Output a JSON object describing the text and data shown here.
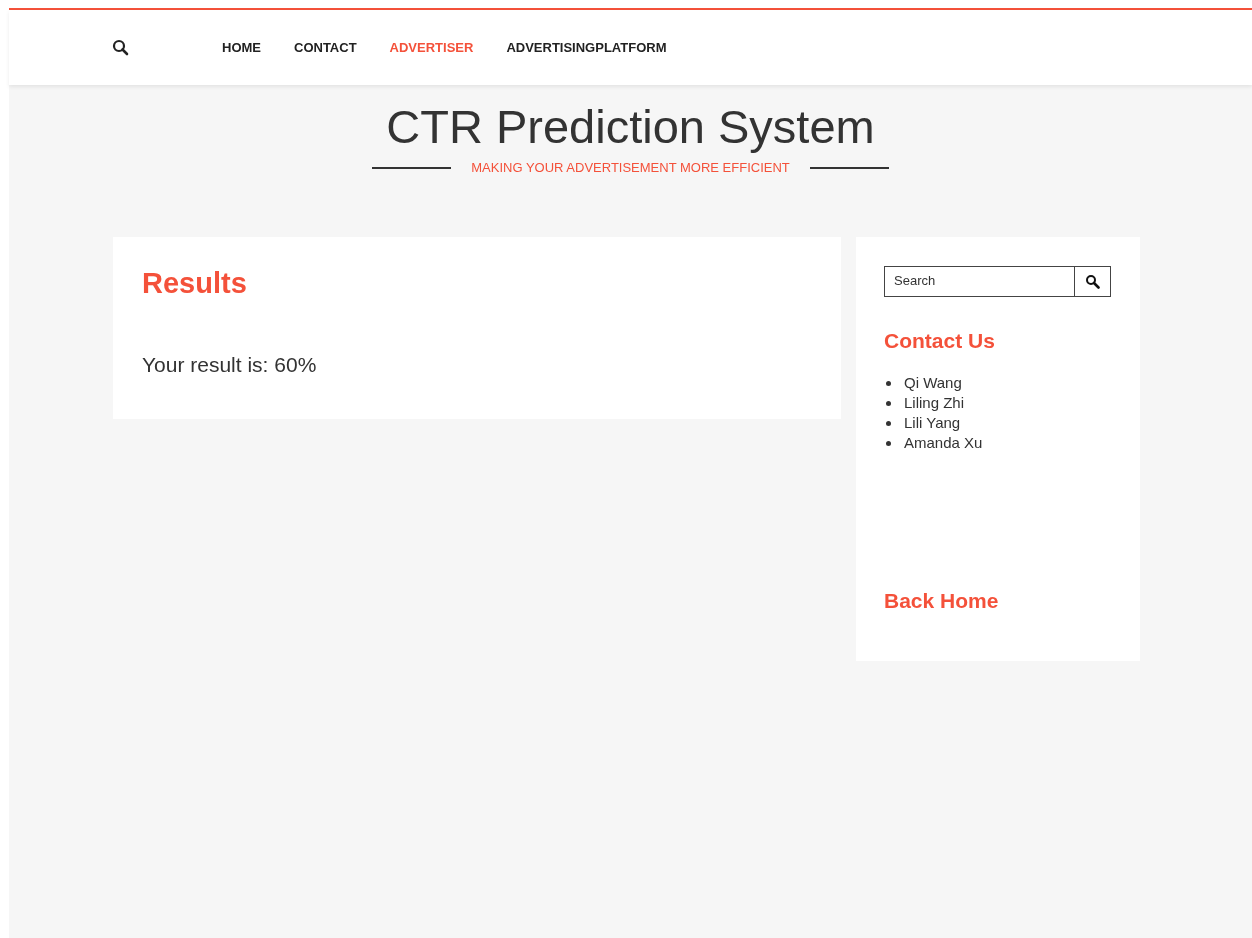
{
  "nav": {
    "items": [
      {
        "label": "HOME",
        "selected": false
      },
      {
        "label": "CONTACT",
        "selected": false
      },
      {
        "label": "ADVERTISER",
        "selected": true
      },
      {
        "label": "ADVERTISINGPLATFORM",
        "selected": false
      }
    ]
  },
  "header": {
    "title": "CTR Prediction System",
    "subtitle": "MAKING YOUR ADVERTISEMENT MORE EFFICIENT"
  },
  "results": {
    "heading": "Results",
    "text": "Your result is: 60%"
  },
  "sidebar": {
    "search": {
      "placeholder": "Search"
    },
    "contact_heading": "Contact Us",
    "contacts": [
      "Qi Wang",
      "Liling Zhi",
      "Lili Yang",
      "Amanda Xu"
    ],
    "back_link": "Back Home"
  }
}
